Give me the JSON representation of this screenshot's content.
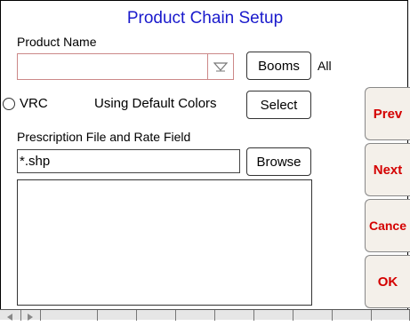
{
  "title": "Product Chain Setup",
  "product_name": {
    "label": "Product Name",
    "value": "",
    "dropdown_icon": "chevron-down-icon"
  },
  "booms": {
    "button_label": "Booms",
    "value": "All"
  },
  "vrc": {
    "radio_label": "VRC",
    "checked": false
  },
  "colors": {
    "status_text": "Using Default Colors",
    "select_label": "Select"
  },
  "prescription": {
    "label": "Prescription File and Rate Field",
    "value": "*.shp",
    "browse_label": "Browse"
  },
  "side_buttons": {
    "prev": "Prev",
    "next": "Next",
    "cancel": "Cance",
    "ok": "OK"
  },
  "bottom_bar": {
    "left_arrow_icon": "arrow-left-icon",
    "right_arrow_icon": "arrow-right-icon"
  },
  "colors_palette": {
    "title": "#1a1acc",
    "button_text": "#d40000",
    "side_button_bg": "#f4f0ea"
  }
}
